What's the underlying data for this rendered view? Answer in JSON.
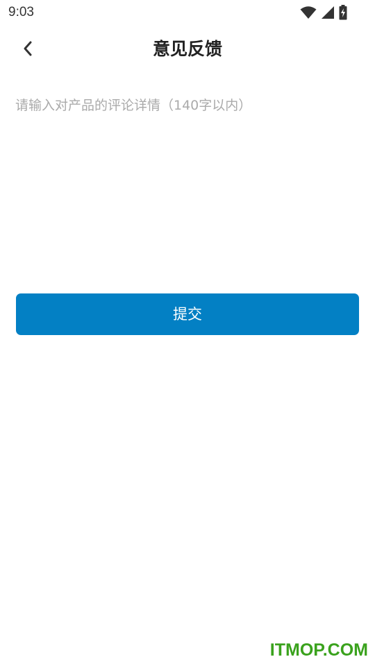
{
  "status_bar": {
    "time": "9:03",
    "icons": [
      "wifi-icon",
      "cellular-signal-icon",
      "battery-charging-icon"
    ]
  },
  "header": {
    "back_icon": "chevron-left-icon",
    "title": "意见反馈"
  },
  "feedback": {
    "value": "",
    "placeholder": "请输入对产品的评论详情（140字以内）"
  },
  "submit": {
    "label": "提交"
  },
  "watermark": {
    "text": "ITMOP.COM"
  },
  "colors": {
    "primary": "#0380c4",
    "placeholder": "#aaaaaa",
    "title": "#222222",
    "watermark": "#3aa21d"
  }
}
